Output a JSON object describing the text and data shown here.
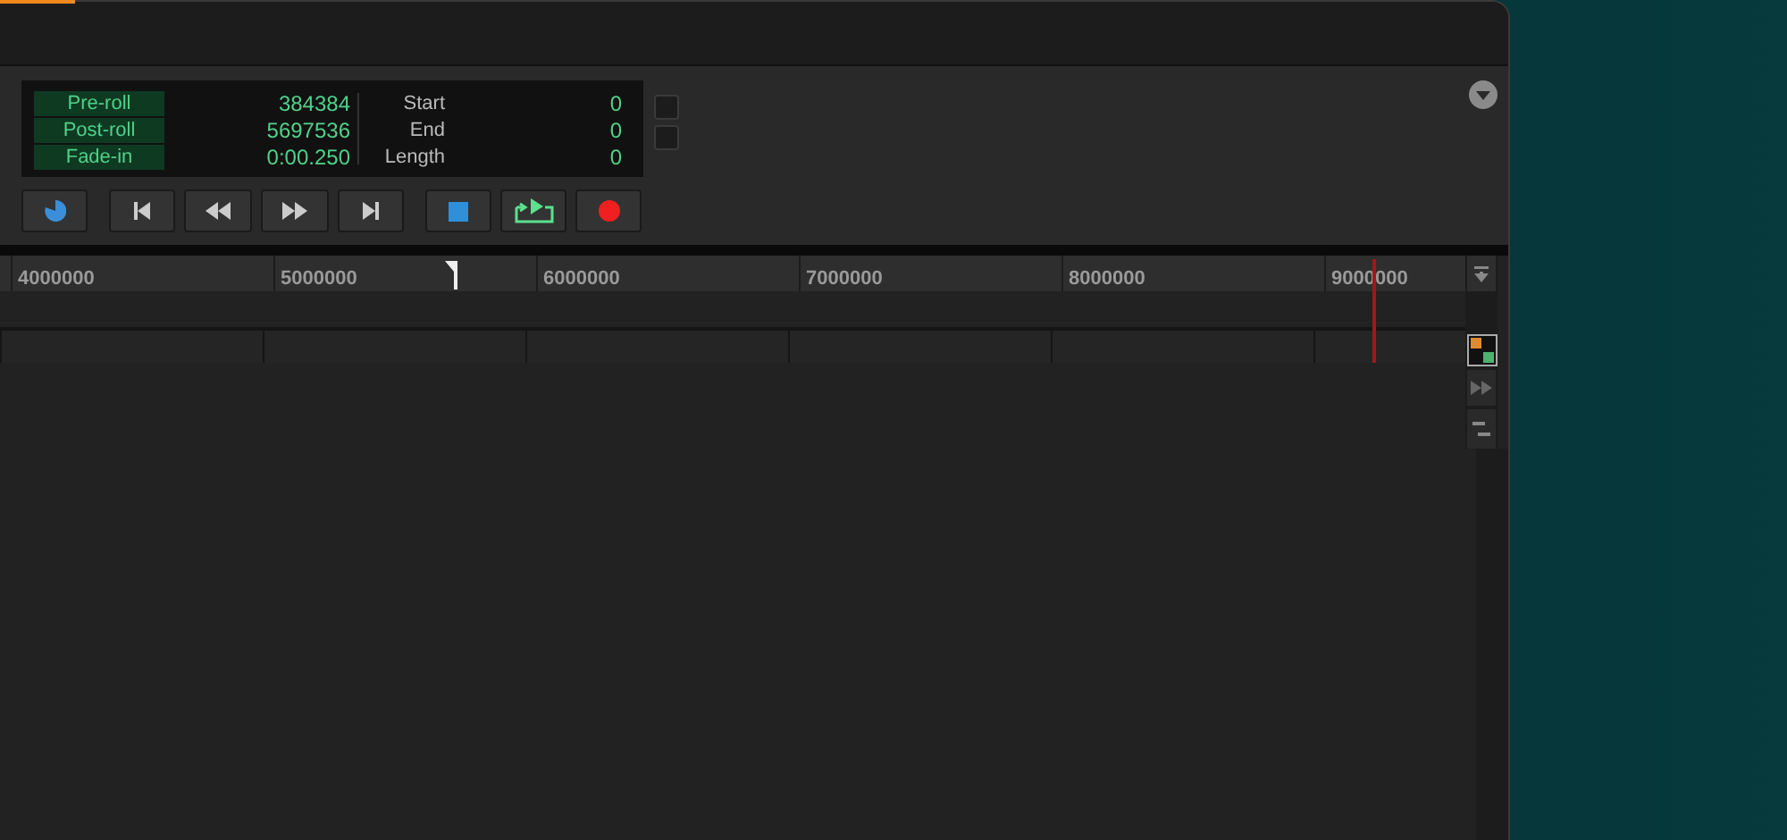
{
  "transport": {
    "left_rows": [
      {
        "label": "Pre-roll",
        "value": "384384"
      },
      {
        "label": "Post-roll",
        "value": "5697536"
      },
      {
        "label": "Fade-in",
        "value": "0:00.250"
      }
    ],
    "right_rows": [
      {
        "label": "Start",
        "value": "0"
      },
      {
        "label": "End",
        "value": "0"
      },
      {
        "label": "Length",
        "value": "0"
      }
    ]
  },
  "ruler": {
    "labels": [
      "4000000",
      "5000000",
      "6000000",
      "7000000",
      "8000000",
      "9000000"
    ]
  }
}
